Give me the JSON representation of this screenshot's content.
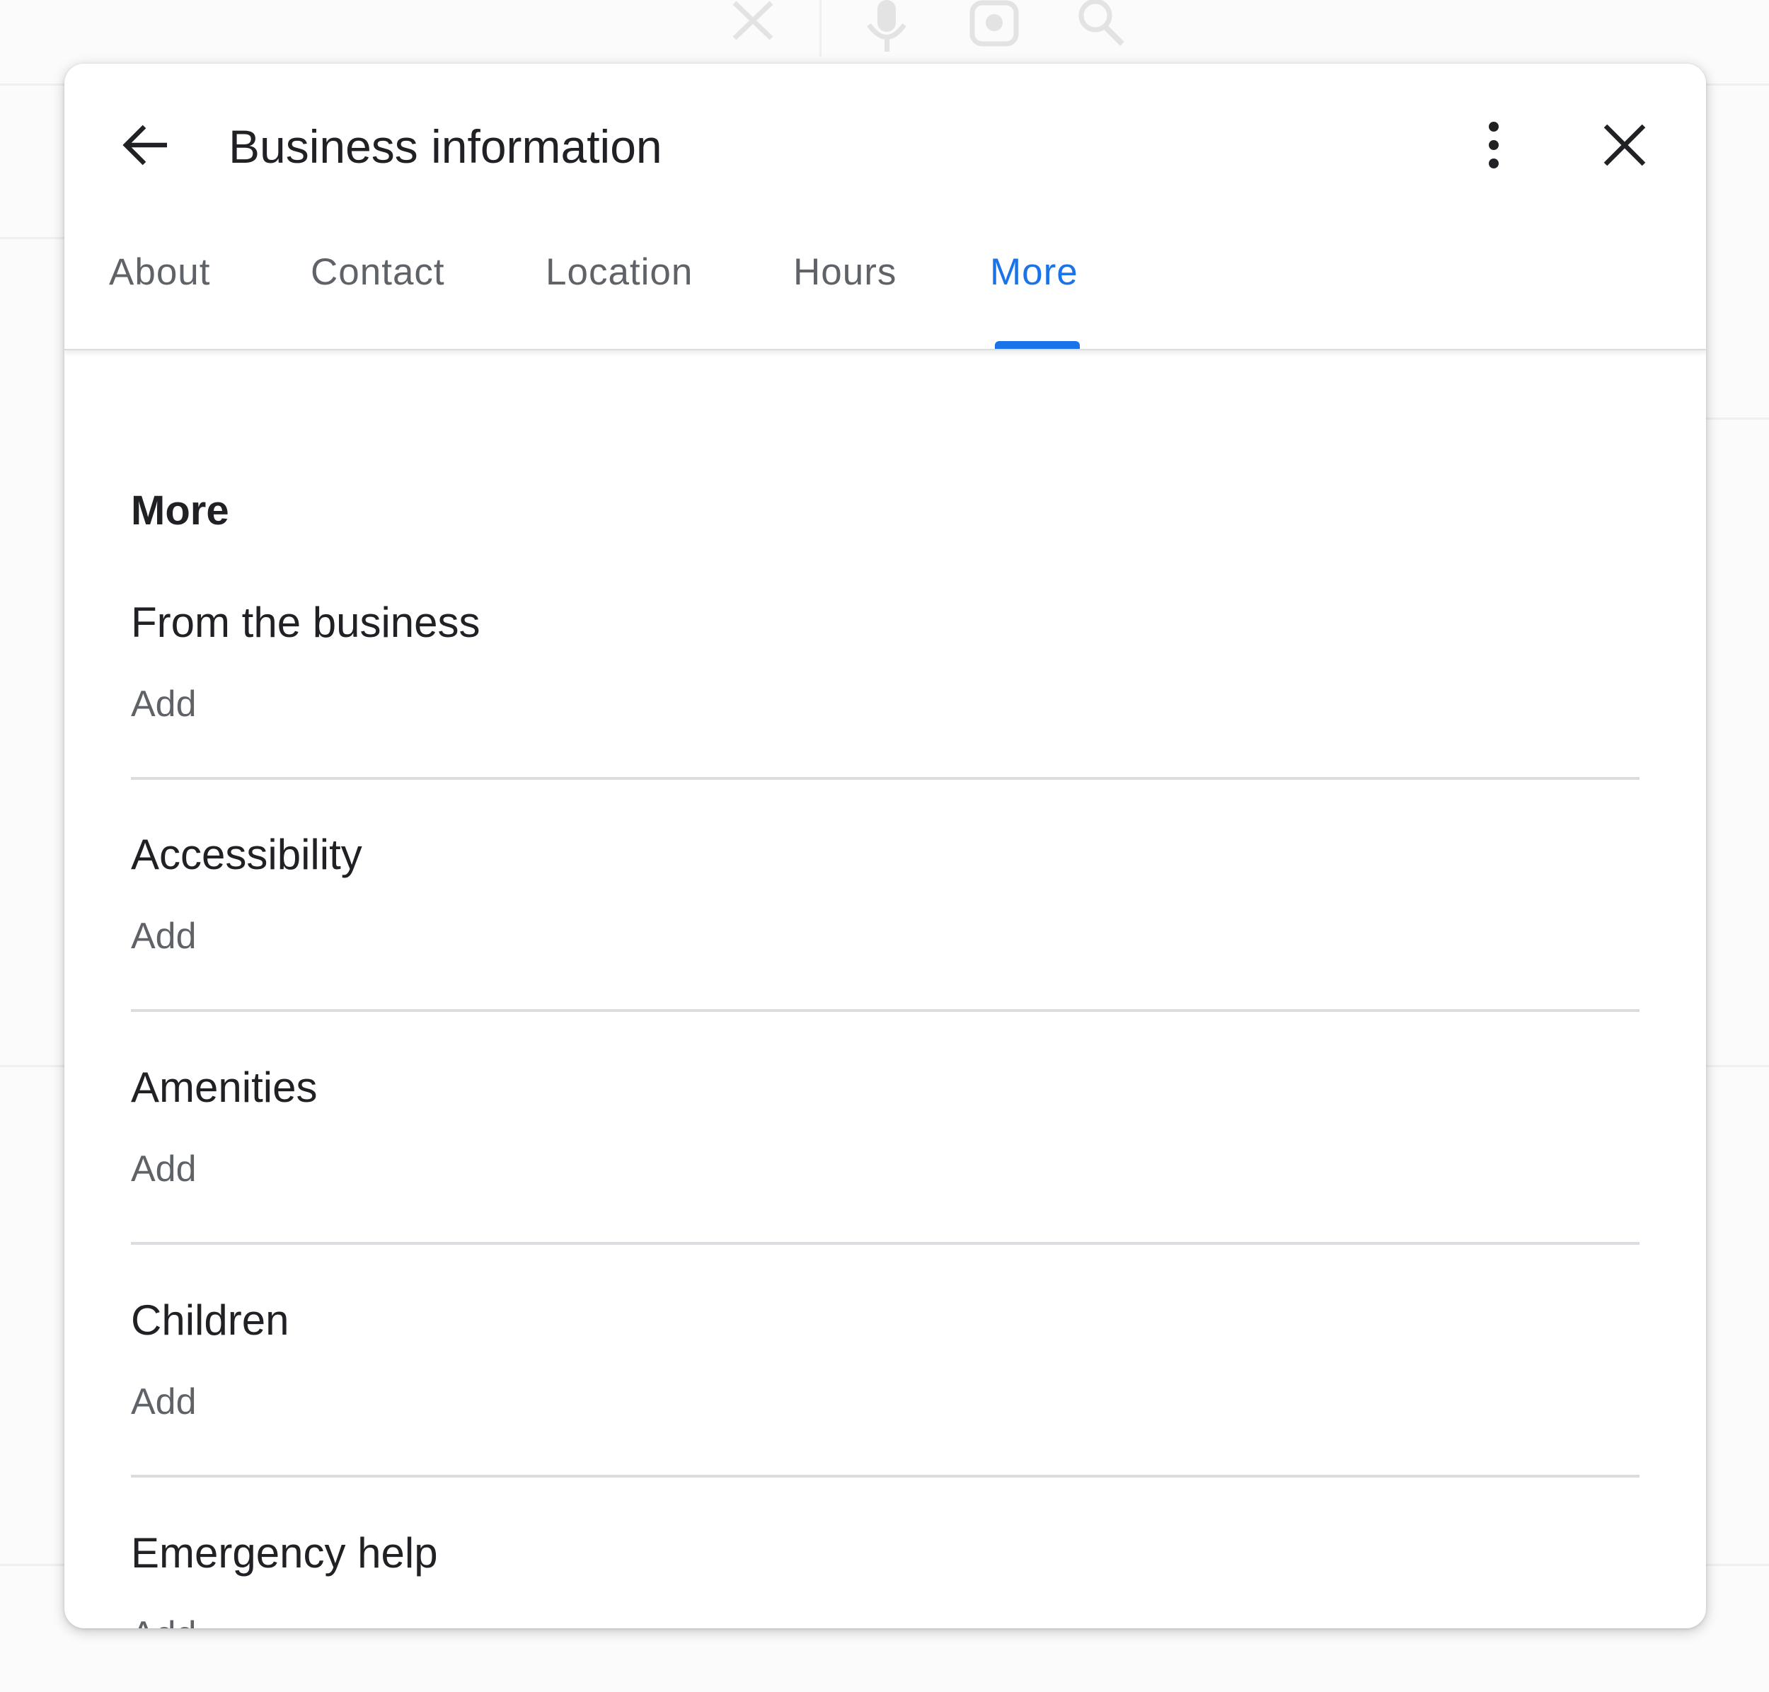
{
  "dialog": {
    "title": "Business information",
    "tabs": [
      {
        "label": "About"
      },
      {
        "label": "Contact"
      },
      {
        "label": "Location"
      },
      {
        "label": "Hours"
      },
      {
        "label": "More"
      }
    ],
    "active_tab": "More",
    "section_title": "More",
    "items": [
      {
        "title": "From the business",
        "action": "Add"
      },
      {
        "title": "Accessibility",
        "action": "Add"
      },
      {
        "title": "Amenities",
        "action": "Add"
      },
      {
        "title": "Children",
        "action": "Add"
      },
      {
        "title": "Emergency help",
        "action": "Add"
      }
    ]
  },
  "colors": {
    "accent": "#1a73e8",
    "text_primary": "#202124",
    "text_secondary": "#5f6368",
    "divider": "#dadce0"
  },
  "icons": {
    "back": "arrow-left-icon",
    "menu": "more-vert-icon",
    "close": "close-icon"
  }
}
